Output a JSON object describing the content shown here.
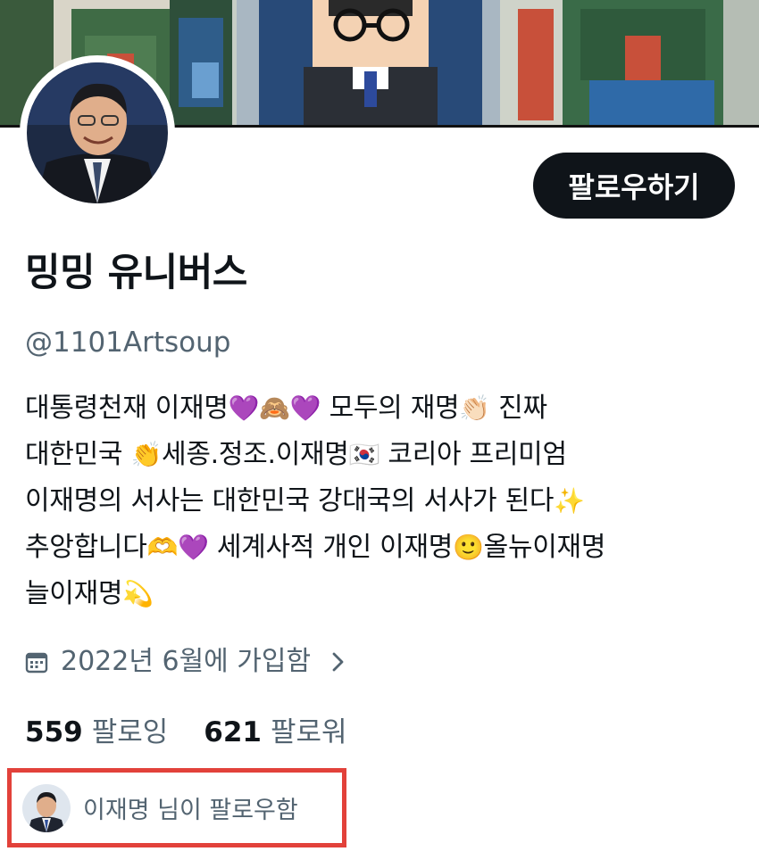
{
  "banner": {
    "description_icon": "pixel-art-banner"
  },
  "profile": {
    "display_name": "밍밍 유니버스",
    "handle": "@1101Artsoup",
    "follow_button_label": "팔로우하기"
  },
  "bio": {
    "line1": {
      "a": "대통령천재 이재명",
      "b": "💜🙈💜",
      "c": "  모두의 재명",
      "d": "👏🏻",
      "e": " 진짜"
    },
    "line2": {
      "a": "대한민국 ",
      "b": "👏",
      "c": "세종.정조.이재명",
      "d": "🇰🇷",
      "e": "  코리아 프리미엄"
    },
    "line3": {
      "a": "이재명의 서사는 대한민국 강대국의 서사가 된다",
      "b": "✨"
    },
    "line4": {
      "a": "추앙합니다",
      "b": "🫶💜",
      "c": " 세계사적 개인 이재명",
      "d": "🙂",
      "e": "올뉴이재명"
    },
    "line5": {
      "a": "늘이재명",
      "b": "💫"
    }
  },
  "joined": {
    "text": "2022년 6월에 가입함",
    "icon": "calendar-icon",
    "chevron": "chevron-right-icon"
  },
  "stats": {
    "following_count": "559",
    "following_label": "팔로잉",
    "followers_count": "621",
    "followers_label": "팔로워"
  },
  "followed_by": {
    "text": "이재명 님이 팔로우함",
    "highlight_color": "#e2413a"
  },
  "colors": {
    "primary_text": "#0f1419",
    "secondary_text": "#536471",
    "button_bg": "#0f1419"
  }
}
